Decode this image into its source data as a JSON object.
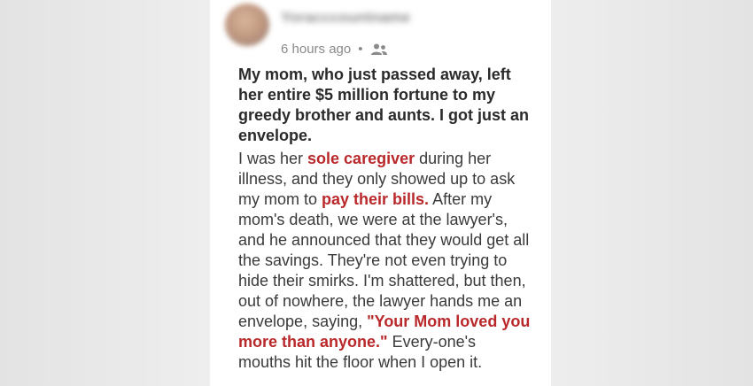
{
  "post": {
    "author": {
      "name": "Yoracccountname"
    },
    "time": "6 hours ago",
    "separator": "•",
    "audience_icon": "people-icon",
    "headline": "My mom, who just passed away, left her entire $5 million fortune to my greedy brother and aunts. I got just an envelope.",
    "body": {
      "part1": "I was her ",
      "highlight1": "sole caregiver",
      "part2": " during her illness, and they only showed up to ask my mom to ",
      "highlight2": "pay their bills.",
      "part3": " After my mom's death, we were at the lawyer's, and he announced that they would get all the savings. They're not even trying to hide their smirks. I'm shattered, but then, out of nowhere, the lawyer hands me an envelope, saying, ",
      "highlight3": "\"Your Mom loved you more than anyone.\"",
      "part4": " Every-one's mouths hit the floor when I open it."
    }
  },
  "colors": {
    "background": "#eeeeee",
    "card": "#ffffff",
    "highlight": "#b9282a",
    "text": "#2d2d2d",
    "muted": "#8a8a8a"
  }
}
